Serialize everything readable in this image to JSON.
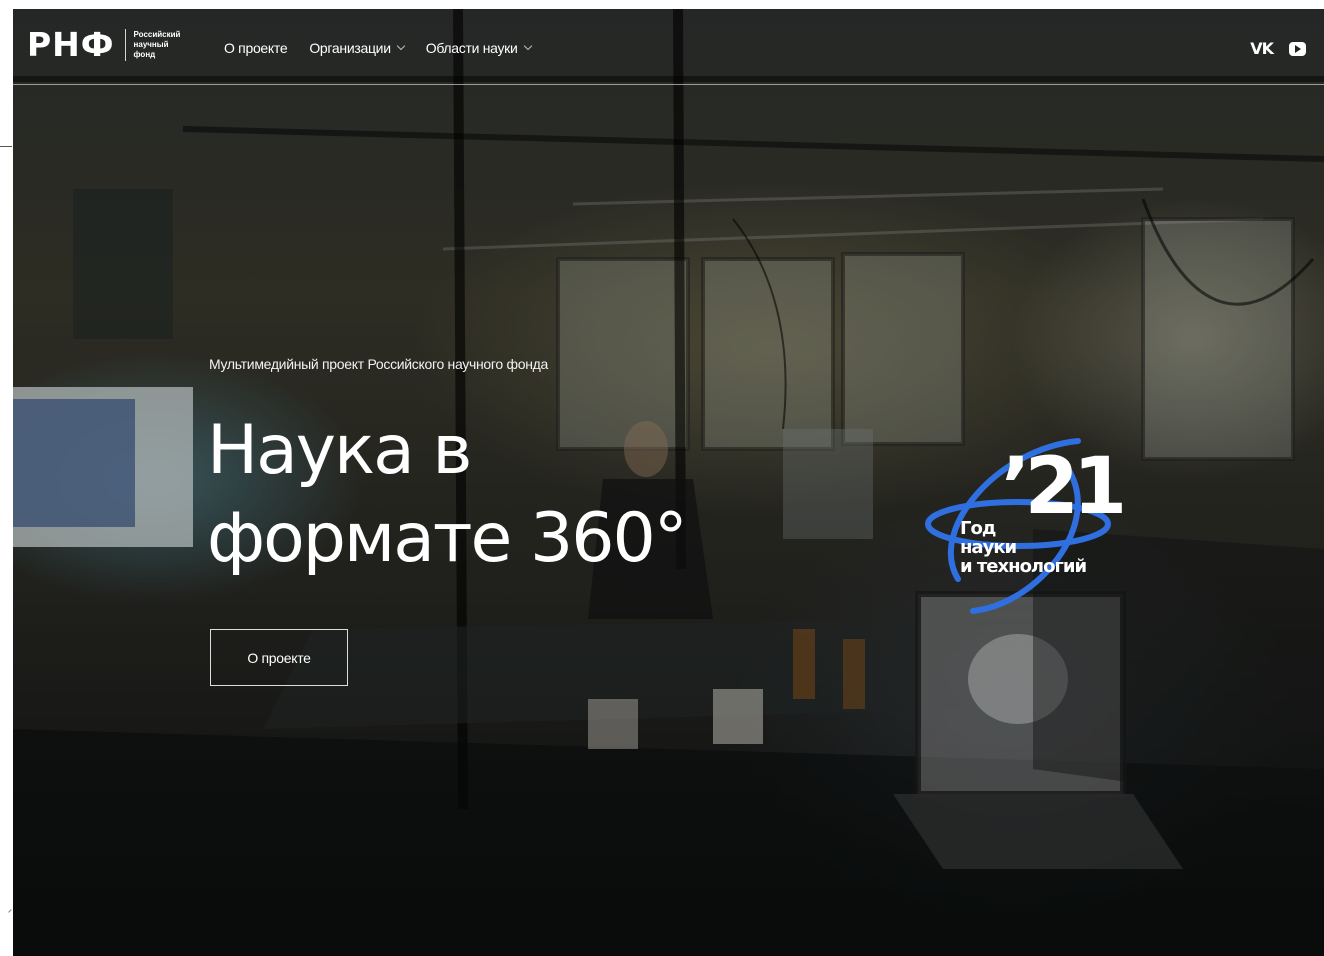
{
  "brand": {
    "logo_mark": "РНФ",
    "logo_lines": [
      "Российский",
      "научный",
      "фонд"
    ]
  },
  "nav": {
    "items": [
      {
        "label": "О проекте",
        "has_dropdown": false
      },
      {
        "label": "Организации",
        "has_dropdown": true
      },
      {
        "label": "Области науки",
        "has_dropdown": true
      }
    ]
  },
  "social": {
    "vk_label": "VK",
    "youtube_icon": "youtube-icon"
  },
  "hero": {
    "subtitle": "Мультимедийный проект Российского научного фонда",
    "title_line1": "Наука в",
    "title_line2": "формате 360°",
    "cta_label": "О проекте"
  },
  "badge": {
    "number": "’21",
    "lines": [
      "Год",
      "науки",
      "и технологий"
    ],
    "ring_color": "#2f6fe0"
  }
}
